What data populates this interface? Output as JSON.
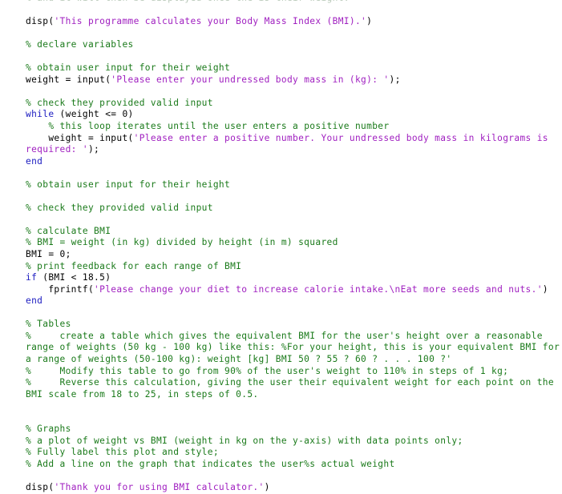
{
  "editor": {
    "language": "matlab",
    "background": "#ffffff",
    "colors": {
      "plain": "#000000",
      "comment": "#1a7a1a",
      "string": "#a020c0",
      "keyword": "#1b1bc0"
    }
  },
  "code": {
    "lines": [
      {
        "id": 0,
        "clipped": true,
        "tokens": [
          {
            "t": "fade",
            "s": "% and it will then be displayed once the is their weight."
          }
        ]
      },
      {
        "id": 1,
        "tokens": []
      },
      {
        "id": 2,
        "tokens": [
          {
            "t": "plain",
            "s": "disp("
          },
          {
            "t": "string",
            "s": "'This programme calculates your Body Mass Index (BMI).'"
          },
          {
            "t": "plain",
            "s": ")"
          }
        ]
      },
      {
        "id": 3,
        "tokens": []
      },
      {
        "id": 4,
        "tokens": [
          {
            "t": "comment",
            "s": "% declare variables"
          }
        ]
      },
      {
        "id": 5,
        "tokens": []
      },
      {
        "id": 6,
        "tokens": [
          {
            "t": "comment",
            "s": "% obtain user input for their weight"
          }
        ]
      },
      {
        "id": 7,
        "tokens": [
          {
            "t": "plain",
            "s": "weight = input("
          },
          {
            "t": "string",
            "s": "'Please enter your undressed body mass in (kg): '"
          },
          {
            "t": "plain",
            "s": ");"
          }
        ]
      },
      {
        "id": 8,
        "tokens": []
      },
      {
        "id": 9,
        "tokens": [
          {
            "t": "comment",
            "s": "% check they provided valid input"
          }
        ]
      },
      {
        "id": 10,
        "tokens": [
          {
            "t": "kw",
            "s": "while"
          },
          {
            "t": "plain",
            "s": " (weight <= 0)"
          }
        ]
      },
      {
        "id": 11,
        "tokens": [
          {
            "t": "comment",
            "s": "    % this loop iterates until the user enters a positive number"
          }
        ]
      },
      {
        "id": 12,
        "tokens": [
          {
            "t": "plain",
            "s": "    weight = input("
          },
          {
            "t": "string",
            "s": "'Please enter a positive number. Your undressed body mass in kilograms is required: '"
          },
          {
            "t": "plain",
            "s": ");"
          }
        ]
      },
      {
        "id": 13,
        "tokens": [
          {
            "t": "kw",
            "s": "end"
          }
        ]
      },
      {
        "id": 14,
        "tokens": []
      },
      {
        "id": 15,
        "tokens": [
          {
            "t": "comment",
            "s": "% obtain user input for their height"
          }
        ]
      },
      {
        "id": 16,
        "tokens": []
      },
      {
        "id": 17,
        "tokens": [
          {
            "t": "comment",
            "s": "% check they provided valid input"
          }
        ]
      },
      {
        "id": 18,
        "tokens": []
      },
      {
        "id": 19,
        "tokens": [
          {
            "t": "comment",
            "s": "% calculate BMI"
          }
        ]
      },
      {
        "id": 20,
        "tokens": [
          {
            "t": "comment",
            "s": "% BMI = weight (in kg) divided by height (in m) squared"
          }
        ]
      },
      {
        "id": 21,
        "tokens": [
          {
            "t": "plain",
            "s": "BMI = 0;"
          }
        ]
      },
      {
        "id": 22,
        "tokens": [
          {
            "t": "comment",
            "s": "% print feedback for each range of BMI"
          }
        ]
      },
      {
        "id": 23,
        "tokens": [
          {
            "t": "kw",
            "s": "if"
          },
          {
            "t": "plain",
            "s": " (BMI < 18.5)"
          }
        ]
      },
      {
        "id": 24,
        "tokens": [
          {
            "t": "plain",
            "s": "    fprintf("
          },
          {
            "t": "string",
            "s": "'Please change your diet to increase calorie intake.\\nEat more seeds and nuts.'"
          },
          {
            "t": "plain",
            "s": ")"
          }
        ]
      },
      {
        "id": 25,
        "tokens": [
          {
            "t": "kw",
            "s": "end"
          }
        ]
      },
      {
        "id": 26,
        "tokens": []
      },
      {
        "id": 27,
        "tokens": [
          {
            "t": "comment",
            "s": "% Tables"
          }
        ]
      },
      {
        "id": 28,
        "tokens": [
          {
            "t": "comment",
            "s": "%     create a table which gives the equivalent BMI for the user's height over a reasonable range of weights (50 kg - 100 kg) like this: %For your height, this is your equivalent BMI for a range of weights (50-100 kg): weight [kg] BMI 50 ? 55 ? 60 ? . . . 100 ?'"
          }
        ]
      },
      {
        "id": 29,
        "tokens": [
          {
            "t": "comment",
            "s": "%     Modify this table to go from 90% of the user's weight to 110% in steps of 1 kg;"
          }
        ]
      },
      {
        "id": 30,
        "tokens": [
          {
            "t": "comment",
            "s": "%     Reverse this calculation, giving the user their equivalent weight for each point on the BMI scale from 18 to 25, in steps of 0.5."
          }
        ]
      },
      {
        "id": 31,
        "tokens": []
      },
      {
        "id": 32,
        "tokens": []
      },
      {
        "id": 33,
        "tokens": [
          {
            "t": "comment",
            "s": "% Graphs"
          }
        ]
      },
      {
        "id": 34,
        "tokens": [
          {
            "t": "comment",
            "s": "% a plot of weight vs BMI (weight in kg on the y-axis) with data points only;"
          }
        ]
      },
      {
        "id": 35,
        "tokens": [
          {
            "t": "comment",
            "s": "% Fully label this plot and style;"
          }
        ]
      },
      {
        "id": 36,
        "tokens": [
          {
            "t": "comment",
            "s": "% Add a line on the graph that indicates the user%s actual weight"
          }
        ]
      },
      {
        "id": 37,
        "tokens": []
      },
      {
        "id": 38,
        "tokens": [
          {
            "t": "plain",
            "s": "disp("
          },
          {
            "t": "string",
            "s": "'Thank you for using BMI calculator.'"
          },
          {
            "t": "plain",
            "s": ")"
          }
        ]
      }
    ]
  }
}
